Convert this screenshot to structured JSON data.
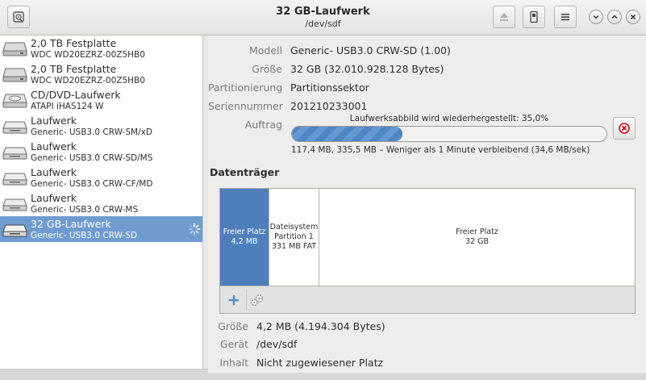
{
  "window": {
    "title": "32 GB-Laufwerk",
    "subtitle": "/dev/sdf"
  },
  "sidebar": {
    "drives": [
      {
        "name": "2,0 TB Festplatte",
        "model": "WDC WD20EZRZ-00Z5HB0",
        "icon": "hard-disk-icon"
      },
      {
        "name": "2,0 TB Festplatte",
        "model": "WDC WD20EZRZ-00Z5HB0",
        "icon": "hard-disk-icon"
      },
      {
        "name": "CD/DVD-Laufwerk",
        "model": "ATAPI   iHAS124   W",
        "icon": "optical-drive-icon"
      },
      {
        "name": "Laufwerk",
        "model": "Generic- USB3.0 CRW-SM/xD",
        "icon": "card-reader-icon"
      },
      {
        "name": "Laufwerk",
        "model": "Generic- USB3.0 CRW-SD/MS",
        "icon": "card-reader-icon"
      },
      {
        "name": "Laufwerk",
        "model": "Generic- USB3.0 CRW-CF/MD",
        "icon": "card-reader-icon"
      },
      {
        "name": "Laufwerk",
        "model": "Generic- USB3.0 CRW-MS",
        "icon": "card-reader-icon"
      },
      {
        "name": "32 GB-Laufwerk",
        "model": "Generic- USB3.0 CRW-SD",
        "icon": "card-reader-icon",
        "selected": true
      }
    ]
  },
  "drive_info": {
    "model_label": "Modell",
    "model_value": "Generic- USB3.0 CRW-SD (1.00)",
    "size_label": "Größe",
    "size_value": "32 GB (32.010.928.128 Bytes)",
    "partitioning_label": "Partitionierung",
    "partitioning_value": "Partitionssektor",
    "serial_label": "Seriennummer",
    "serial_value": "201210233001",
    "job_label": "Auftrag",
    "job_title": "Laufwerksabbild wird wiederhergestellt: 35,0%",
    "job_progress_percent": 35.0,
    "job_details": "117,4 MB, 335,5 MB – Weniger als 1 Minute verbleibend (34,6 MB/sek)"
  },
  "volumes": {
    "section_title": "Datenträger",
    "segments": [
      {
        "line1": "Freier Platz",
        "line2": "4,2 MB",
        "line3": "",
        "selected": true
      },
      {
        "line1": "Dateisystem",
        "line2": "Partition 1",
        "line3": "331 MB FAT",
        "selected": false
      },
      {
        "line1": "Freier Platz",
        "line2": "32 GB",
        "line3": "",
        "selected": false
      }
    ]
  },
  "volume_info": {
    "size_label": "Größe",
    "size_value": "4,2 MB (4.194.304 Bytes)",
    "device_label": "Gerät",
    "device_value": "/dev/sdf",
    "contents_label": "Inhalt",
    "contents_value": "Nicht zugewiesener Platz"
  },
  "colors": {
    "selection": "#6f9bd0",
    "volume_selected": "#4f7fbb",
    "progress": "#4f86c6",
    "cancel": "#d0021b"
  }
}
